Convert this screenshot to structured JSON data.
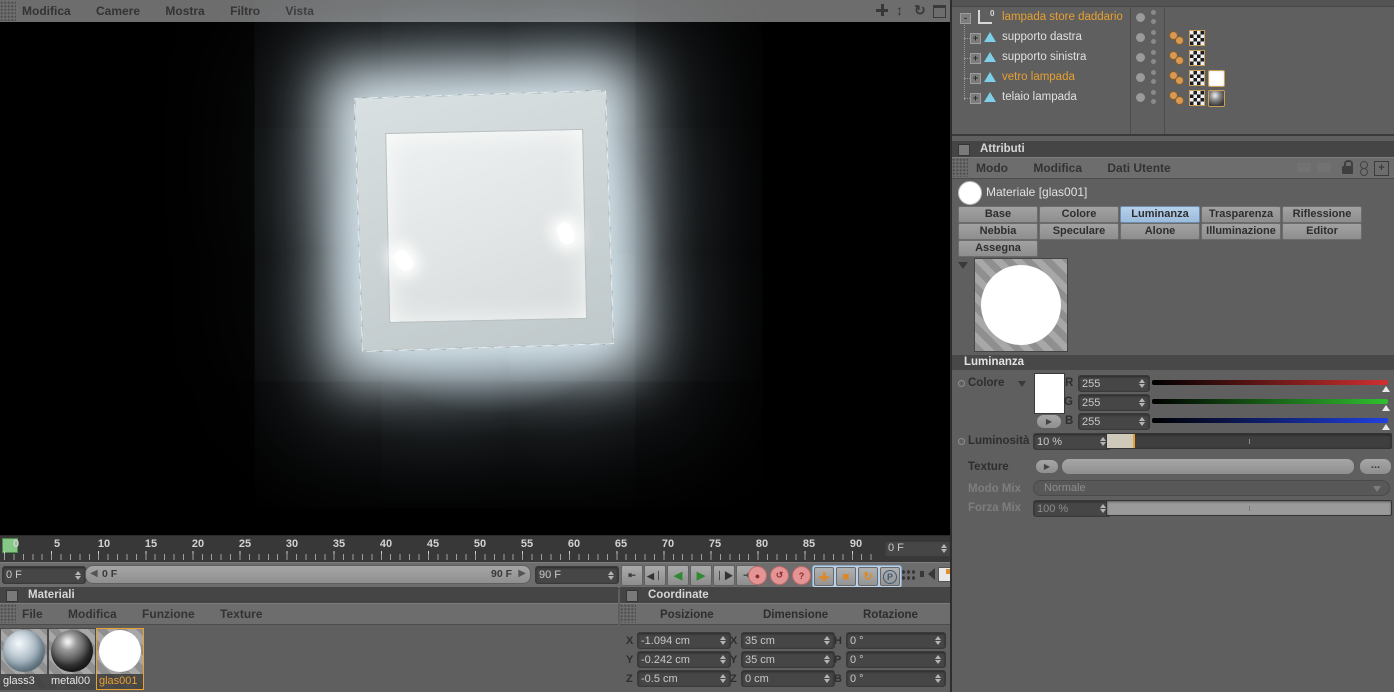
{
  "viewport_menu": {
    "items": [
      "Modifica",
      "Camere",
      "Mostra",
      "Filtro",
      "Vista"
    ]
  },
  "object_manager": {
    "items": [
      {
        "label": "lampada store daddario",
        "selected": true,
        "expander": "-",
        "type": "null-object"
      },
      {
        "label": "supporto dastra",
        "selected": false,
        "expander": "+",
        "type": "polygon-object"
      },
      {
        "label": "supporto sinistra",
        "selected": false,
        "expander": "+",
        "type": "polygon-object"
      },
      {
        "label": "vetro lampada",
        "selected": true,
        "expander": "+",
        "type": "polygon-object"
      },
      {
        "label": "telaio lampada",
        "selected": false,
        "expander": "+",
        "type": "polygon-object"
      }
    ]
  },
  "attributes": {
    "title": "Attributi",
    "menu": [
      "Modo",
      "Modifica",
      "Dati Utente"
    ],
    "material_title": "Materiale [glas001]",
    "tabs_row1": [
      "Base",
      "Colore",
      "Luminanza",
      "Trasparenza",
      "Riflessione"
    ],
    "tabs_row2": [
      "Nebbia",
      "Speculare",
      "Alone",
      "Illuminazione",
      "Editor"
    ],
    "tabs_row3": [
      "Assegna"
    ],
    "active_tab": "Luminanza",
    "section_title": "Luminanza",
    "colore_label": "Colore",
    "channels": [
      {
        "label": "R",
        "value": "255",
        "color": "#d03030"
      },
      {
        "label": "G",
        "value": "255",
        "color": "#30c030"
      },
      {
        "label": "B",
        "value": "255",
        "color": "#2040e0"
      }
    ],
    "luminosita_label": "Luminosità",
    "luminosita_value": "10 %",
    "texture_label": "Texture",
    "texture_browse": "...",
    "modo_mix_label": "Modo Mix",
    "modo_mix_value": "Normale",
    "forza_mix_label": "Forza Mix",
    "forza_mix_value": "100 %"
  },
  "timeline": {
    "ruler_labels": [
      "0",
      "5",
      "10",
      "15",
      "20",
      "25",
      "30",
      "35",
      "40",
      "45",
      "50",
      "55",
      "60",
      "65",
      "70",
      "75",
      "80",
      "85",
      "90"
    ],
    "frame_field_top": "0 F",
    "current_frame": "0 F",
    "range_start": "0 F",
    "range_end": "90 F",
    "end_frame": "90 F"
  },
  "materials_panel": {
    "title": "Materiali",
    "menu": [
      "File",
      "Modifica",
      "Funzione",
      "Texture"
    ],
    "materials": [
      {
        "name": "glass3",
        "selected": false
      },
      {
        "name": "metal00",
        "selected": false
      },
      {
        "name": "glas001",
        "selected": true
      }
    ],
    "accent_color": "#e8a030"
  },
  "coordinates": {
    "title": "Coordinate",
    "col_posizione": "Posizione",
    "col_dimensione": "Dimensione",
    "col_rotazione": "Rotazione",
    "rows": [
      {
        "axis": "X",
        "pos": "-1.094 cm",
        "dim_axis": "X",
        "dim": "35 cm",
        "rot_axis": "H",
        "rot": "0 °"
      },
      {
        "axis": "Y",
        "pos": "-0.242 cm",
        "dim_axis": "Y",
        "dim": "35 cm",
        "rot_axis": "P",
        "rot": "0 °"
      },
      {
        "axis": "Z",
        "pos": "-0.5 cm",
        "dim_axis": "Z",
        "dim": "0 cm",
        "rot_axis": "B",
        "rot": "0 °"
      }
    ]
  }
}
